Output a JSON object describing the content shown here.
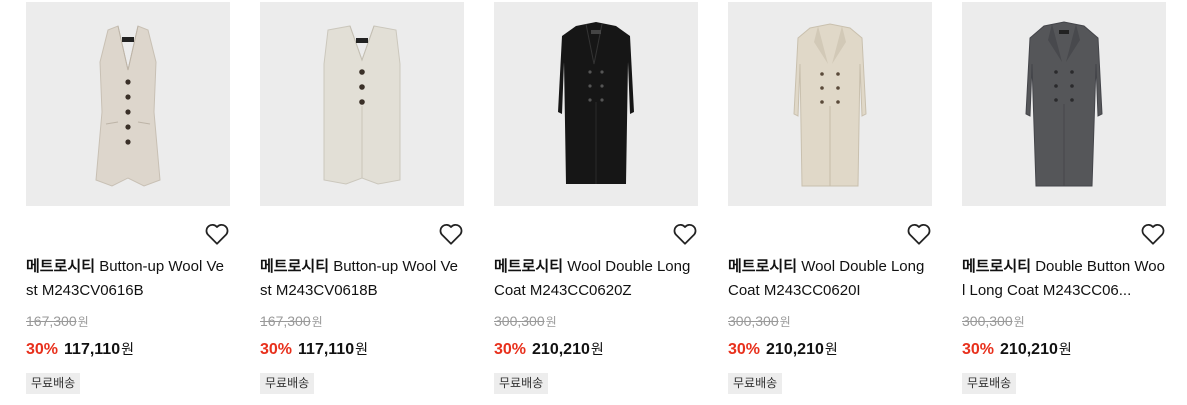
{
  "currency": "원",
  "products": [
    {
      "brand": "메트로시티",
      "name": "Button-up Wool Vest M243CV0616B",
      "original_price": "167,300",
      "discount": "30%",
      "sale_price": "117,110",
      "badge": "무료배송",
      "image": "beige-button-up-vest",
      "color": "#ddd6cc"
    },
    {
      "brand": "메트로시티",
      "name": "Button-up Wool Vest M243CV0618B",
      "original_price": "167,300",
      "discount": "30%",
      "sale_price": "117,110",
      "badge": "무료배송",
      "image": "beige-long-vest",
      "color": "#e2dfd6"
    },
    {
      "brand": "메트로시티",
      "name": "Wool Double Long Coat M243CC0620Z",
      "original_price": "300,300",
      "discount": "30%",
      "sale_price": "210,210",
      "badge": "무료배송",
      "image": "black-double-long-coat",
      "color": "#161616"
    },
    {
      "brand": "메트로시티",
      "name": "Wool Double Long Coat M243CC0620I",
      "original_price": "300,300",
      "discount": "30%",
      "sale_price": "210,210",
      "badge": "무료배송",
      "image": "beige-double-long-coat",
      "color": "#e0d8c8"
    },
    {
      "brand": "메트로시티",
      "name": "Double Button Wool Long Coat M243CC06...",
      "original_price": "300,300",
      "discount": "30%",
      "sale_price": "210,210",
      "badge": "무료배송",
      "image": "gray-double-button-long-coat",
      "color": "#555659"
    }
  ]
}
